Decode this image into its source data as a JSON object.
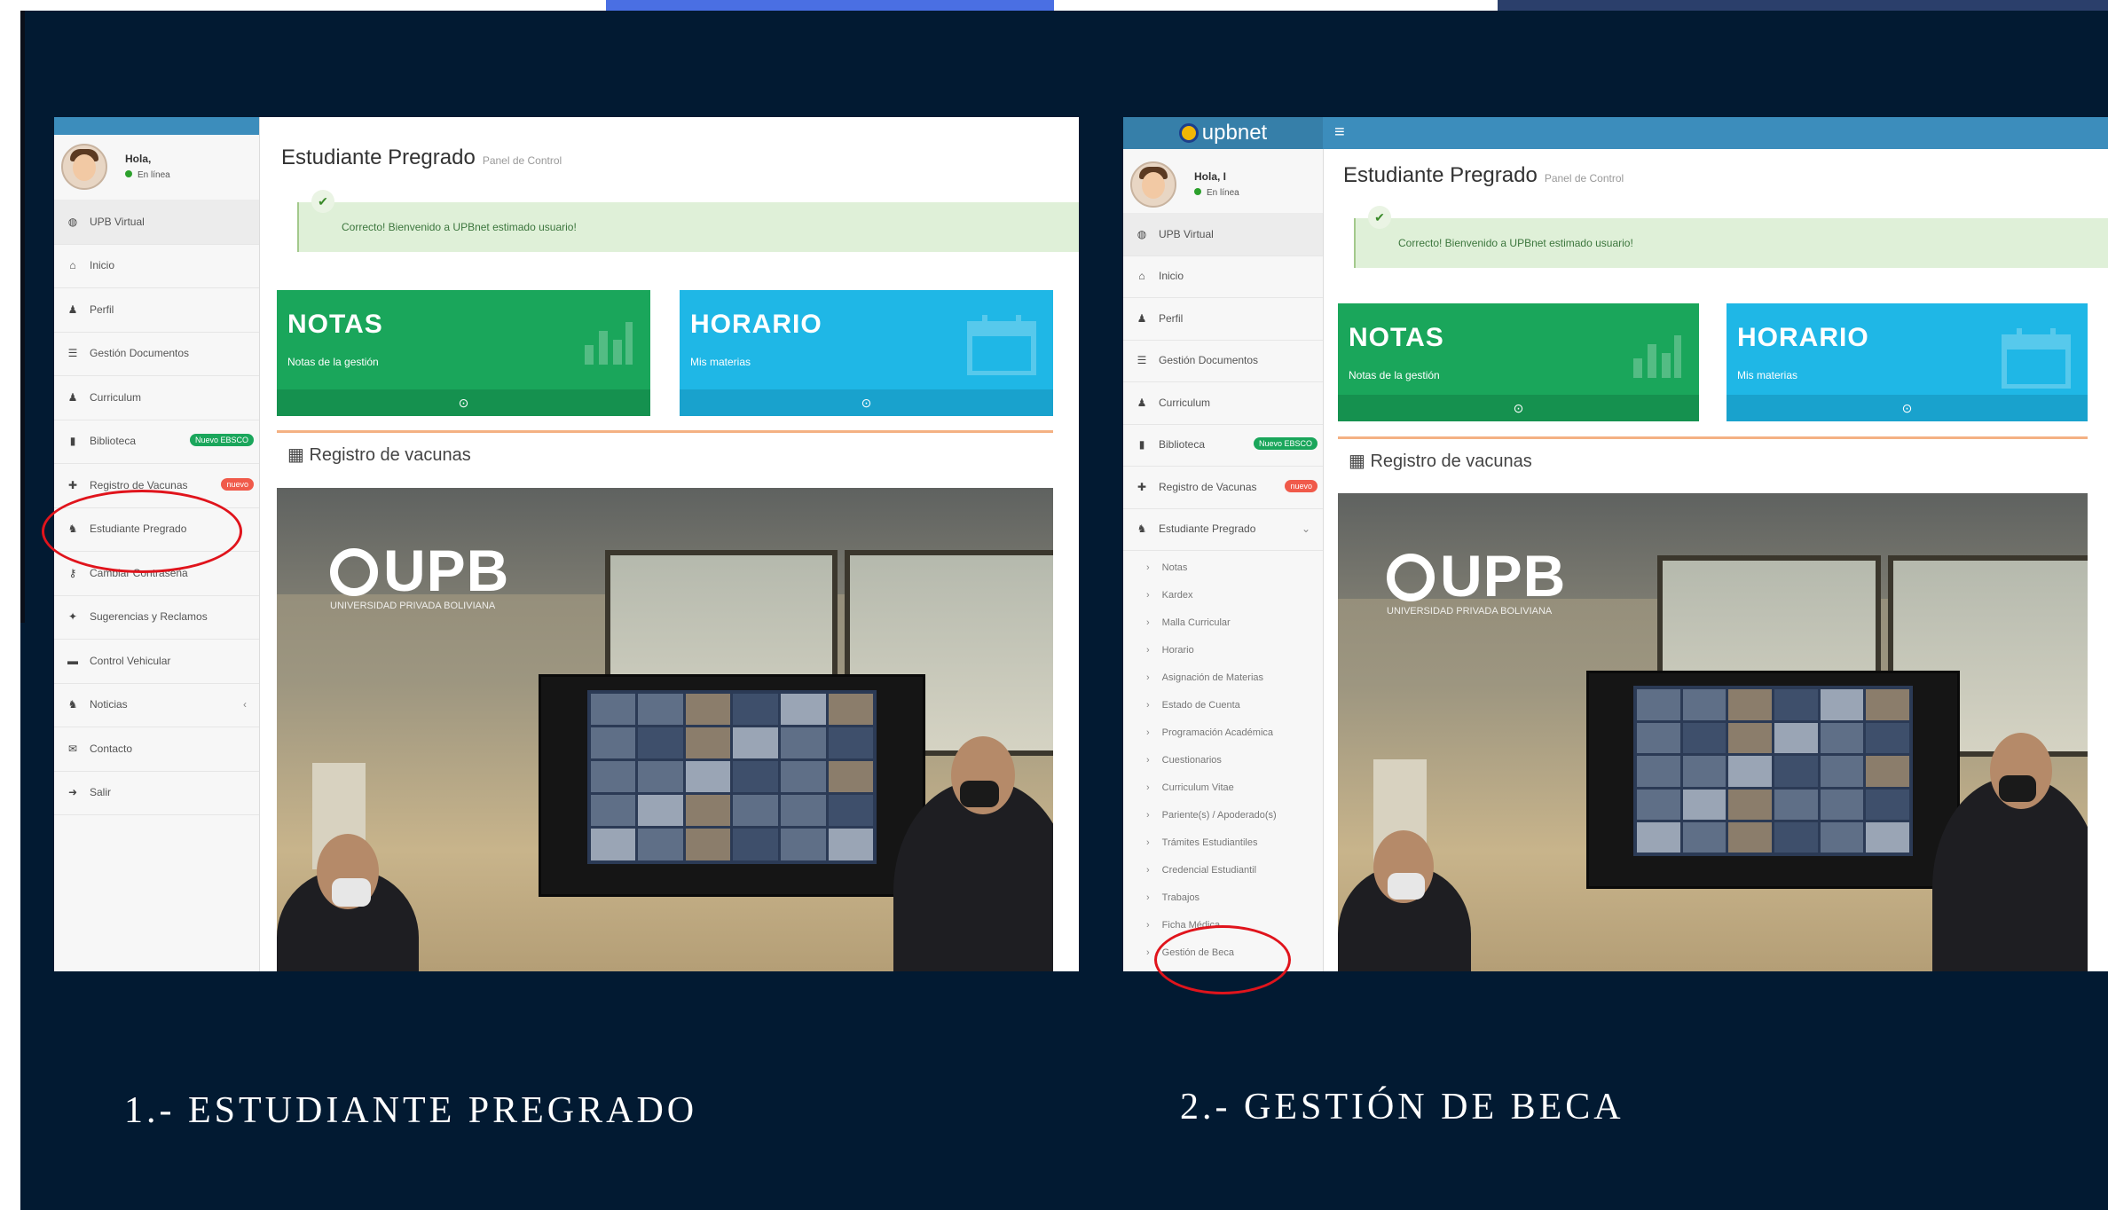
{
  "colors": {
    "slide_bg": "#021a32",
    "topbar_accent": "#4a6fe3",
    "topbar_dark": "#2b3f6b",
    "tile_green": "#1aa65b",
    "tile_blue": "#1fb7e6",
    "highlight_red": "#e0141c",
    "header_blue": "#3c8dbc"
  },
  "left": {
    "user": {
      "greeting": "Hola,",
      "status": "En línea"
    },
    "menu": [
      {
        "icon": "globe-icon",
        "label": "UPB Virtual"
      },
      {
        "icon": "home-icon",
        "label": "Inicio"
      },
      {
        "icon": "user-icon",
        "label": "Perfil"
      },
      {
        "icon": "list-icon",
        "label": "Gestión Documentos"
      },
      {
        "icon": "user-icon",
        "label": "Curriculum"
      },
      {
        "icon": "book-icon",
        "label": "Biblioteca",
        "badge": "Nuevo EBSCO"
      },
      {
        "icon": "plus-icon",
        "label": "Registro de Vacunas",
        "badge": "nuevo"
      },
      {
        "icon": "users-icon",
        "label": "Estudiante Pregrado"
      },
      {
        "icon": "key-icon",
        "label": "Cambiar Contraseña"
      },
      {
        "icon": "thumb-icon",
        "label": "Sugerencias y Reclamos"
      },
      {
        "icon": "car-icon",
        "label": "Control Vehicular"
      },
      {
        "icon": "users-icon",
        "label": "Noticias",
        "chevron": "‹"
      },
      {
        "icon": "envelope-icon",
        "label": "Contacto"
      },
      {
        "icon": "signout-icon",
        "label": "Salir"
      }
    ],
    "title": "Estudiante Pregrado",
    "subtitle": "Panel de Control",
    "alert": "Correcto! Bienvenido a UPBnet estimado usuario!",
    "tiles": [
      {
        "title": "NOTAS",
        "sub": "Notas de la gestión"
      },
      {
        "title": "HORARIO",
        "sub": "Mis materias"
      }
    ],
    "section": "Registro de vacunas",
    "logo": {
      "text": "UPB",
      "sub": "UNIVERSIDAD PRIVADA BOLIVIANA"
    },
    "caption": "1.- ESTUDIANTE PREGRADO"
  },
  "right": {
    "brand": "upbnet",
    "user": {
      "greeting": "Hola, I",
      "status": "En línea"
    },
    "menu": [
      {
        "icon": "globe-icon",
        "label": "UPB Virtual"
      },
      {
        "icon": "home-icon",
        "label": "Inicio"
      },
      {
        "icon": "user-icon",
        "label": "Perfil"
      },
      {
        "icon": "list-icon",
        "label": "Gestión Documentos"
      },
      {
        "icon": "user-icon",
        "label": "Curriculum"
      },
      {
        "icon": "book-icon",
        "label": "Biblioteca",
        "badge": "Nuevo EBSCO"
      },
      {
        "icon": "plus-icon",
        "label": "Registro de Vacunas",
        "badge": "nuevo"
      },
      {
        "icon": "users-icon",
        "label": "Estudiante Pregrado",
        "chevron": "⌄"
      }
    ],
    "submenu": [
      "Notas",
      "Kardex",
      "Malla Curricular",
      "Horario",
      "Asignación de Materias",
      "Estado de Cuenta",
      "Programación Académica",
      "Cuestionarios",
      "Curriculum Vitae",
      "Pariente(s) / Apoderado(s)",
      "Trámites Estudiantiles",
      "Credencial Estudiantil",
      "Trabajos",
      "Ficha Médica",
      "Gestión de Beca"
    ],
    "title": "Estudiante Pregrado",
    "subtitle": "Panel de Control",
    "alert": "Correcto! Bienvenido a UPBnet estimado usuario!",
    "tiles": [
      {
        "title": "NOTAS",
        "sub": "Notas de la gestión"
      },
      {
        "title": "HORARIO",
        "sub": "Mis materias"
      }
    ],
    "section": "Registro de vacunas",
    "logo": {
      "text": "UPB",
      "sub": "UNIVERSIDAD PRIVADA BOLIVIANA"
    },
    "caption": "2.- GESTIÓN DE BECA"
  }
}
